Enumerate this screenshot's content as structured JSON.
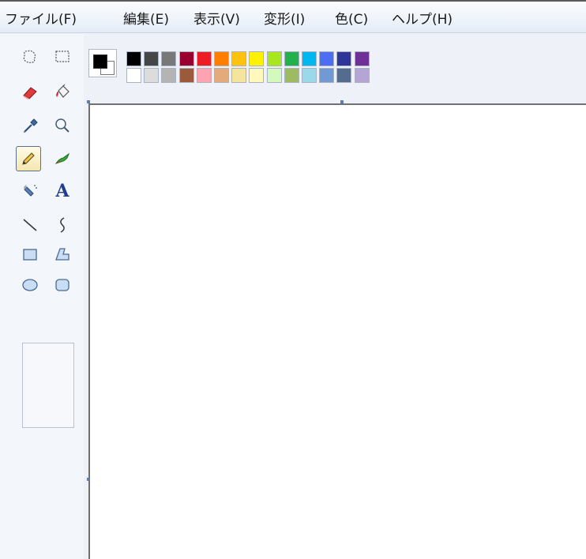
{
  "menu": [
    "ファイル(F)",
    "編集(E)",
    "表示(V)",
    "変形(I)",
    "色(C)",
    "ヘルプ(H)"
  ],
  "tools": [
    {
      "name": "free-form-select-icon"
    },
    {
      "name": "rectangle-select-icon"
    },
    {
      "name": "eraser-icon"
    },
    {
      "name": "fill-bucket-icon"
    },
    {
      "name": "color-picker-icon"
    },
    {
      "name": "magnifier-icon"
    },
    {
      "name": "pencil-icon",
      "selected": true
    },
    {
      "name": "brush-icon"
    },
    {
      "name": "airbrush-icon"
    },
    {
      "name": "text-icon",
      "glyph": "A"
    },
    {
      "name": "line-icon"
    },
    {
      "name": "curve-icon"
    },
    {
      "name": "rectangle-icon"
    },
    {
      "name": "polygon-icon"
    },
    {
      "name": "ellipse-icon"
    },
    {
      "name": "rounded-rectangle-icon"
    }
  ],
  "colors": {
    "foreground": "#000000",
    "background": "#ffffff",
    "palette_top": [
      "#000000",
      "#464646",
      "#787878",
      "#990030",
      "#ed1c24",
      "#ff7e00",
      "#ffc20e",
      "#fff200",
      "#a8e61d",
      "#22b14c",
      "#00b7ef",
      "#4d6df3",
      "#2f3699",
      "#6f3198"
    ],
    "palette_bottom": [
      "#ffffff",
      "#dcdcdc",
      "#b4b4b4",
      "#9c5a3c",
      "#ffa3b1",
      "#e5aa7a",
      "#f5e49c",
      "#fff9bd",
      "#d3f9bc",
      "#9dbb61",
      "#99d9ea",
      "#709ad1",
      "#546d8e",
      "#b5a5d5"
    ]
  }
}
